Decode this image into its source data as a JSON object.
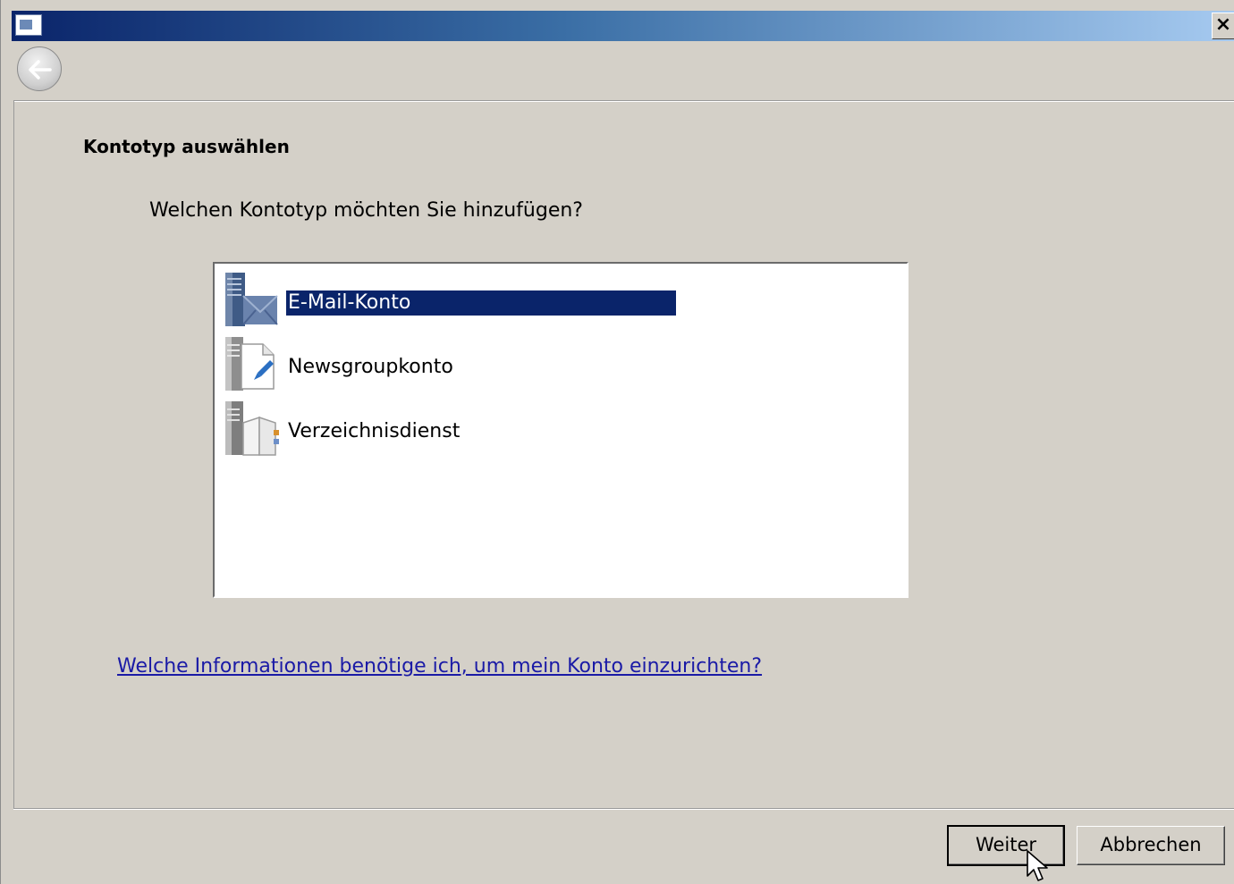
{
  "titlebar": {
    "title": "",
    "close_label": "×"
  },
  "header": {
    "back_icon": "back-arrow-icon"
  },
  "main": {
    "page_title": "Kontotyp auswählen",
    "question": "Welchen Kontotyp möchten Sie hinzufügen?",
    "account_types": [
      {
        "label": "E-Mail-Konto",
        "icon": "mail-server-icon",
        "selected": true
      },
      {
        "label": "Newsgroupkonto",
        "icon": "newsgroup-icon",
        "selected": false
      },
      {
        "label": "Verzeichnisdienst",
        "icon": "directory-service-icon",
        "selected": false
      }
    ],
    "help_link": "Welche Informationen benötige ich, um mein Konto einzurichten?"
  },
  "footer": {
    "next_label": "Weiter",
    "cancel_label": "Abbrechen"
  },
  "colors": {
    "selection": "#0a246a",
    "link": "#1a1aa6",
    "dialog_bg": "#d4d0c8"
  }
}
